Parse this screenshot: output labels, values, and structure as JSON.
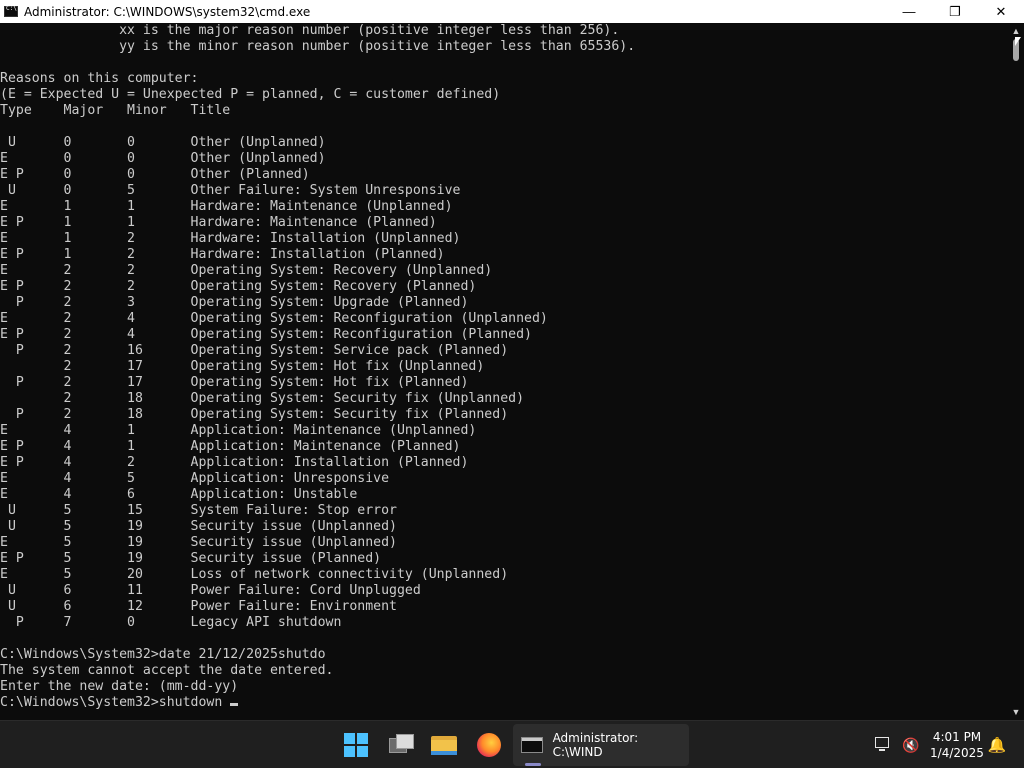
{
  "window": {
    "title": "Administrator: C:\\WINDOWS\\system32\\cmd.exe",
    "controls": {
      "minimize": "—",
      "maximize": "❐",
      "close": "✕"
    }
  },
  "console": {
    "lines": [
      "               xx is the major reason number (positive integer less than 256).",
      "               yy is the minor reason number (positive integer less than 65536).",
      "",
      "Reasons on this computer:",
      "(E = Expected U = Unexpected P = planned, C = customer defined)",
      "Type    Major   Minor   Title",
      "",
      " U      0       0       Other (Unplanned)",
      "E       0       0       Other (Unplanned)",
      "E P     0       0       Other (Planned)",
      " U      0       5       Other Failure: System Unresponsive",
      "E       1       1       Hardware: Maintenance (Unplanned)",
      "E P     1       1       Hardware: Maintenance (Planned)",
      "E       1       2       Hardware: Installation (Unplanned)",
      "E P     1       2       Hardware: Installation (Planned)",
      "E       2       2       Operating System: Recovery (Unplanned)",
      "E P     2       2       Operating System: Recovery (Planned)",
      "  P     2       3       Operating System: Upgrade (Planned)",
      "E       2       4       Operating System: Reconfiguration (Unplanned)",
      "E P     2       4       Operating System: Reconfiguration (Planned)",
      "  P     2       16      Operating System: Service pack (Planned)",
      "        2       17      Operating System: Hot fix (Unplanned)",
      "  P     2       17      Operating System: Hot fix (Planned)",
      "        2       18      Operating System: Security fix (Unplanned)",
      "  P     2       18      Operating System: Security fix (Planned)",
      "E       4       1       Application: Maintenance (Unplanned)",
      "E P     4       1       Application: Maintenance (Planned)",
      "E P     4       2       Application: Installation (Planned)",
      "E       4       5       Application: Unresponsive",
      "E       4       6       Application: Unstable",
      " U      5       15      System Failure: Stop error",
      " U      5       19      Security issue (Unplanned)",
      "E       5       19      Security issue (Unplanned)",
      "E P     5       19      Security issue (Planned)",
      "E       5       20      Loss of network connectivity (Unplanned)",
      " U      6       11      Power Failure: Cord Unplugged",
      " U      6       12      Power Failure: Environment",
      "  P     7       0       Legacy API shutdown",
      "",
      "C:\\Windows\\System32>date 21/12/2025shutdo",
      "The system cannot accept the date entered.",
      "Enter the new date: (mm-dd-yy)"
    ],
    "prompt_line": "C:\\Windows\\System32>shutdown "
  },
  "taskbar": {
    "start_icon": "windows-start-icon",
    "task_view_icon": "task-view-icon",
    "explorer_icon": "file-explorer-icon",
    "firefox_icon": "firefox-icon",
    "active_window_label": "Administrator: C:\\WIND",
    "clock": {
      "time": "4:01 PM",
      "date": "1/4/2025"
    },
    "tray_icons": [
      "network-icon",
      "volume-icon",
      "notification-bell-icon"
    ]
  },
  "colors": {
    "console_bg": "#0c0c0c",
    "console_text": "#cccccc",
    "taskbar_bg": "#1f1f1f",
    "titlebar_bg": "#ffffff",
    "start_accent": "#4cc2ff"
  }
}
